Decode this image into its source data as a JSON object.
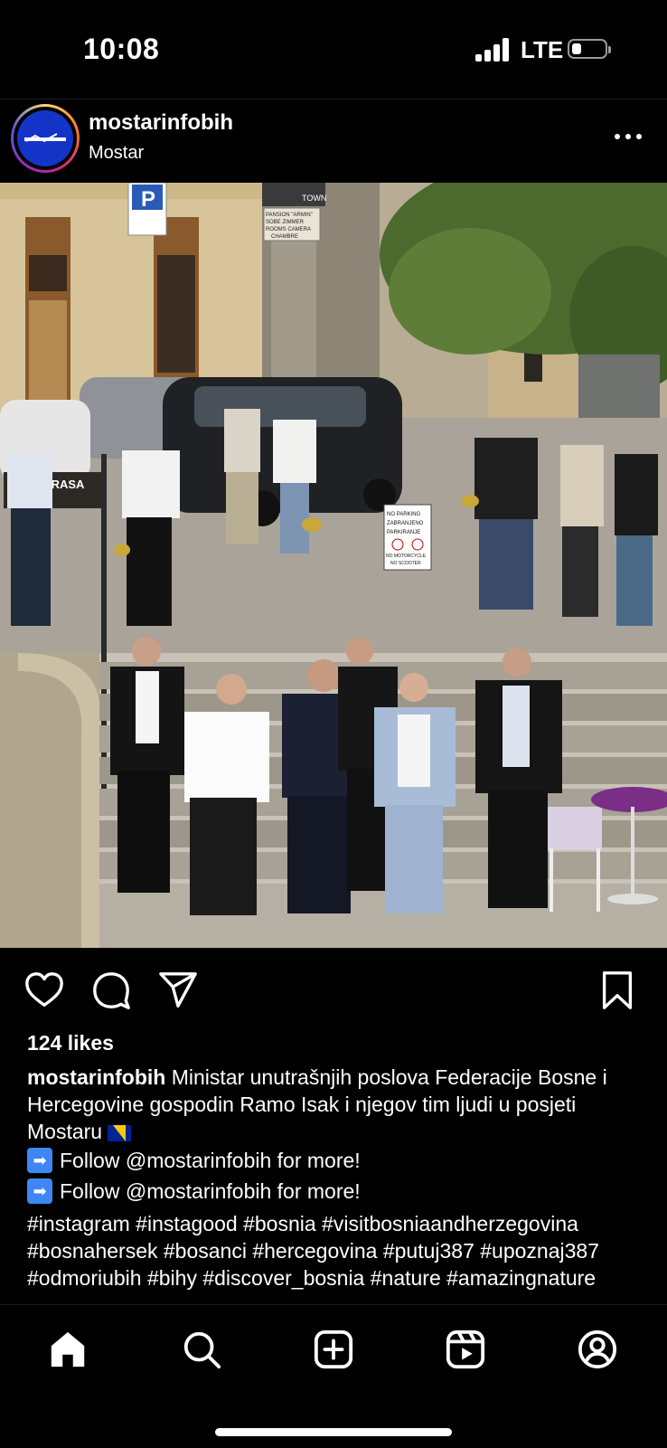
{
  "status_bar": {
    "time": "10:08",
    "network": "LTE"
  },
  "post": {
    "username": "mostarinfobih",
    "location": "Mostar",
    "likes": "124 likes",
    "caption_user": "mostarinfobih",
    "caption_text": "Ministar unutrašnjih poslova Federacije Bosne i Hercegovine gospodin Ramo Isak i njegov tim ljudi  u posjeti Mostaru",
    "follow_lines": [
      "Follow @mostarinfobih for more!",
      "Follow @mostarinfobih for more!"
    ],
    "hashtags": "#instagram #instagood #bosnia #visitbosniaandherzegovina #bosnahersek #bosanci #hercegovina #putuj387 #upoznaj387 #odmoriubih #bihy #discover_bosnia #nature #amazingnature"
  },
  "photo_signs": {
    "parking": "P",
    "town": "TOWN",
    "pansion": "PANSION \"ARMIN\"",
    "sobe": "SOBE ZIMMER",
    "rooms": "ROOMS CAMERA",
    "chambre": "CHAMBRE",
    "terasa": "TERASA",
    "no_parking": "NO PARKING",
    "zabranjeno": "ZABRANJENO",
    "parkiranje": "PARKIRANJE",
    "no_moto": "NO MOTORCYCLE",
    "no_scooter": "NO SCOOTER"
  },
  "icons": {
    "like": "heart-icon",
    "comment": "comment-icon",
    "share": "send-icon",
    "save": "bookmark-icon",
    "home": "home-icon",
    "search": "search-icon",
    "create": "plus-square-icon",
    "reels": "reels-icon",
    "profile": "profile-icon"
  },
  "colors": {
    "background": "#000000",
    "text": "#ffffff",
    "avatar_blue": "#1434c8",
    "emoji_blue": "#3d86f4"
  }
}
